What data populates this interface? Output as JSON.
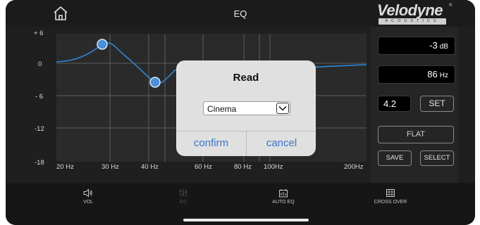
{
  "header": {
    "title": "EQ",
    "home_icon": "home-icon"
  },
  "logo": {
    "brand": "Velodyne",
    "registered": "®",
    "sub": "ACOUSTICS"
  },
  "eq_chart": {
    "y_labels": [
      "+ 6",
      "0",
      "- 6",
      "-12",
      "-18"
    ],
    "x_labels": [
      "20 Hz",
      "30 Hz",
      "40 Hz",
      "60 Hz",
      "80 Hz",
      "100Hz",
      "200Hz"
    ],
    "curve_color": "#2f86d6",
    "handle_color": "#4a8fd8"
  },
  "side_panel": {
    "gain": {
      "value": "-3",
      "unit": "dB"
    },
    "frequency": {
      "value": "86",
      "unit": "Hz"
    },
    "q": {
      "value": "4.2"
    },
    "set_label": "SET",
    "flat_label": "FLAT",
    "save_label": "SAVE",
    "select_label": "SELECT"
  },
  "bottom_nav": {
    "tabs": [
      {
        "label": "VOL",
        "icon": "speaker-icon",
        "active": true
      },
      {
        "label": "EQ",
        "icon": "sliders-icon",
        "active": false
      },
      {
        "label": "AUTO EQ",
        "icon": "auto-eq-icon",
        "active": true
      },
      {
        "label": "CROSS OVER",
        "icon": "crossover-icon",
        "active": true
      }
    ]
  },
  "dialog": {
    "title": "Read",
    "selected_preset": "Cinema",
    "confirm_label": "confirm",
    "cancel_label": "cancel",
    "accent": "#3b73c8"
  }
}
